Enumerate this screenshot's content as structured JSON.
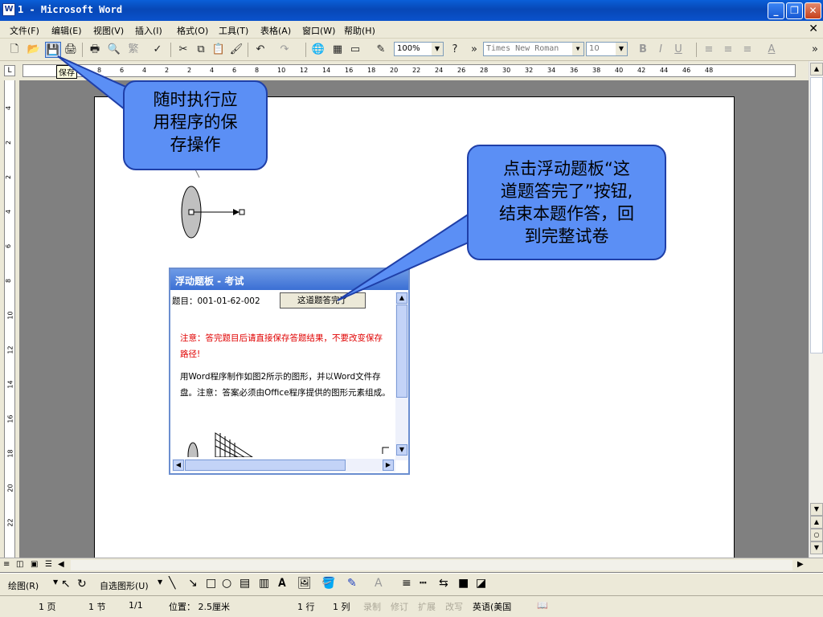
{
  "window": {
    "title": "1 - Microsoft Word",
    "icon_text": "W"
  },
  "menu": [
    "文件(F)",
    "编辑(E)",
    "视图(V)",
    "插入(I)",
    "格式(O)",
    "工具(T)",
    "表格(A)",
    "窗口(W)",
    "帮助(H)"
  ],
  "toolbar": {
    "zoom": "100%",
    "font": "Times New Roman",
    "size": "10",
    "trad_label": "繁",
    "save_tooltip": "保存"
  },
  "ruler_h": [
    "8",
    "6",
    "4",
    "2",
    "2",
    "4",
    "6",
    "8",
    "10",
    "12",
    "14",
    "16",
    "18",
    "20",
    "22",
    "24",
    "26",
    "28",
    "30",
    "32",
    "34",
    "36",
    "38",
    "40",
    "42",
    "44",
    "46",
    "48"
  ],
  "ruler_v": [
    "4",
    "2",
    "2",
    "4",
    "6",
    "8",
    "10",
    "12",
    "14",
    "16",
    "18",
    "20",
    "22"
  ],
  "callouts": {
    "save": [
      "随时执行应",
      "用程序的保",
      "存操作"
    ],
    "finish": [
      "点击浮动题板“这",
      "道题答完了”按钮,",
      "结束本题作答，回",
      "到完整试卷"
    ]
  },
  "float_panel": {
    "title": "浮动题板 - 考试",
    "question_id": "题目：001-01-62-002",
    "done_button": "这道题答完了",
    "notice": "注意：答完题目后请直接保存答题结果，不要改变保存路径!",
    "task": "用Word程序制作如图2所示的图形，并以Word文件存盘。注意：答案必须由Office程序提供的图形元素组成。"
  },
  "draw_toolbar": {
    "draw": "绘图(R)",
    "autoshape": "自选图形(U)"
  },
  "status": {
    "page": "1 页",
    "section": "1 节",
    "pages": "1/1",
    "position": "位置： 2.5厘米",
    "line": "1 行",
    "col": "1 列",
    "rec": "录制",
    "trk": "修订",
    "ext": "扩展",
    "ovr": "改写",
    "lang": "英语(美国"
  }
}
